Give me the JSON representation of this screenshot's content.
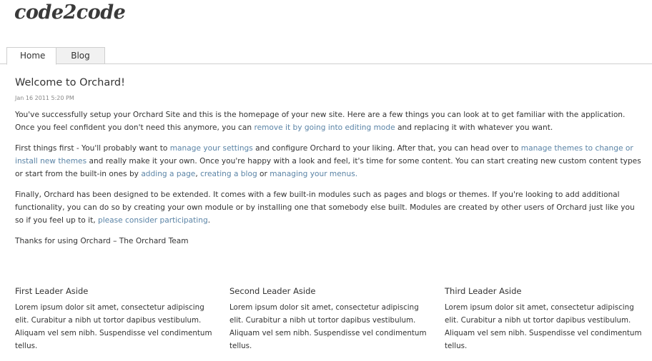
{
  "site": {
    "title": "code2code"
  },
  "nav": {
    "tabs": [
      {
        "label": "Home"
      },
      {
        "label": "Blog"
      }
    ]
  },
  "post": {
    "title": "Welcome to Orchard!",
    "date": "Jan 16 2011 5:20 PM",
    "p1": {
      "t1": "You've successfully setup your Orchard Site and this is the homepage of your new site. Here are a few things you can look at to get familiar with the application. Once you feel confident you don't need this anymore, you can ",
      "link1": "remove it by going into editing mode",
      "t2": " and replacing it with whatever you want."
    },
    "p2": {
      "t1": "First things first - You'll probably want to ",
      "link1": "manage your settings",
      "t2": " and configure Orchard to your liking. After that, you can head over to ",
      "link2": "manage themes to change or install new themes",
      "t3": " and really make it your own. Once you're happy with a look and feel, it's time for some content. You can start creating new custom content types or start from the built-in ones by ",
      "link3": "adding a page",
      "t4": ", ",
      "link4": "creating a blog",
      "t5": " or ",
      "link5": "managing your menus.",
      "t6": ""
    },
    "p3": {
      "t1": "Finally, Orchard has been designed to be extended. It comes with a few built-in modules such as pages and blogs or themes. If you're looking to add additional functionality, you can do so by creating your own module or by installing one that somebody else built. Modules are created by other users of Orchard just like you so if you feel up to it, ",
      "link1": "please consider participating",
      "t2": "."
    },
    "p4": {
      "t1": "Thanks for using Orchard – The Orchard Team"
    }
  },
  "asides": [
    {
      "title": "First Leader Aside",
      "body": "Lorem ipsum dolor sit amet, consectetur adipiscing elit. Curabitur a nibh ut tortor dapibus vestibulum. Aliquam vel sem nibh. Suspendisse vel condimentum tellus."
    },
    {
      "title": "Second Leader Aside",
      "body": "Lorem ipsum dolor sit amet, consectetur adipiscing elit. Curabitur a nibh ut tortor dapibus vestibulum. Aliquam vel sem nibh. Suspendisse vel condimentum tellus."
    },
    {
      "title": "Third Leader Aside",
      "body": "Lorem ipsum dolor sit amet, consectetur adipiscing elit. Curabitur a nibh ut tortor dapibus vestibulum. Aliquam vel sem nibh. Suspendisse vel condimentum tellus."
    }
  ],
  "colors": {
    "link": "#5b84a6",
    "text": "#333333",
    "date": "#888888",
    "tab_inactive_bg": "#f1f1f1",
    "border": "#cfcfcf"
  }
}
